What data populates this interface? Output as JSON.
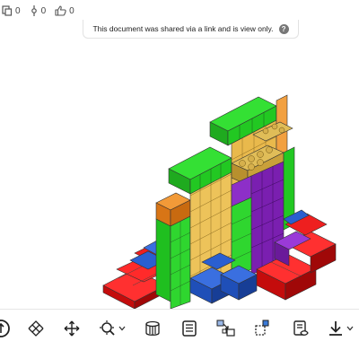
{
  "stats": {
    "documents": "0",
    "versions": "0",
    "likes": "0"
  },
  "banner": {
    "text": "This document was shared via a link and is view only.",
    "help": "?"
  },
  "colors": {
    "green": "#22cc22",
    "red": "#dd1111",
    "blue": "#1f4fb8",
    "purple": "#7a1fb0",
    "yellow": "#e8b84a",
    "orange": "#e07a1a",
    "gold": "#c8a040"
  },
  "toolbar": {
    "icons": [
      "view-cube-icon",
      "rotate-icon",
      "pan-icon",
      "zoom-icon",
      "section-view-icon",
      "notes-icon",
      "exploded-view-icon",
      "measure-icon",
      "named-views-icon",
      "download-icon"
    ]
  }
}
